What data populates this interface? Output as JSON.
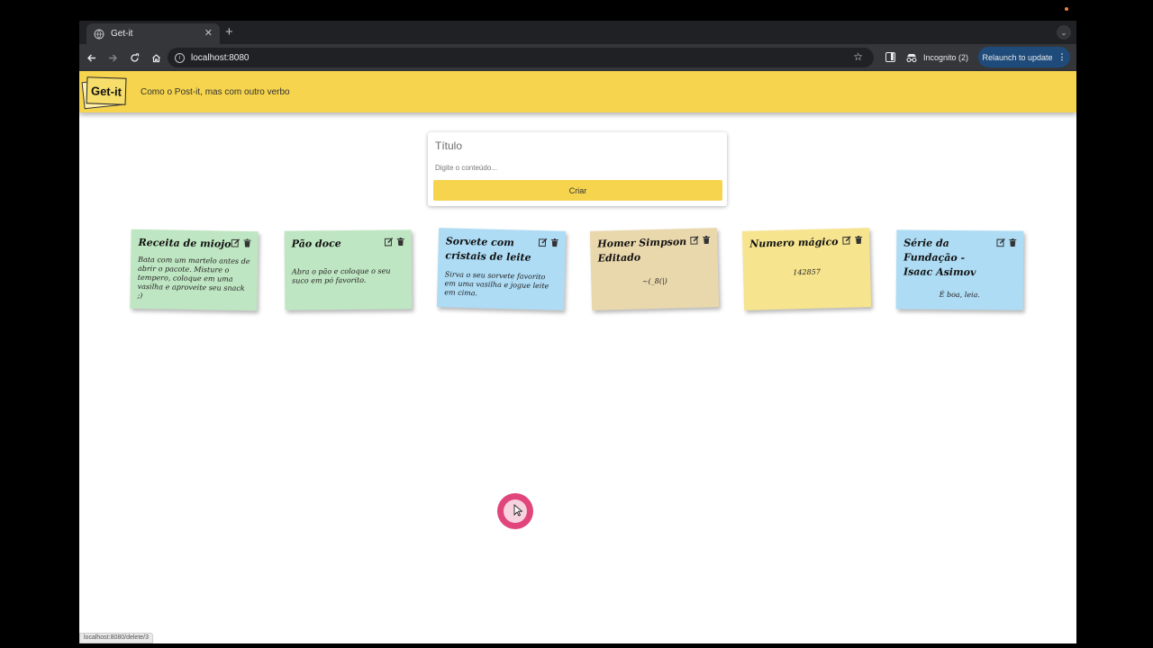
{
  "browser": {
    "tab_title": "Get-it",
    "tab_close": "✕",
    "new_tab": "+",
    "tab_search": "⌄",
    "url": "localhost:8080",
    "incognito_label": "Incognito (2)",
    "relaunch_label": "Relaunch to update",
    "status_url": "localhost:8080/delete/3"
  },
  "app": {
    "logo_text": "Get-it",
    "tagline": "Como o Post-it, mas com outro verbo"
  },
  "form": {
    "title_placeholder": "Título",
    "content_placeholder": "Digite o conteúdo...",
    "create_label": "Criar"
  },
  "notes": [
    {
      "title": "Receita de miojo",
      "body": "Bata com um martelo antes de abrir o pacote. Misture o tempero, coloque em uma vasilha e aproveite seu snack ;)",
      "color": "#bfe6c2"
    },
    {
      "title": "Pão doce",
      "body": "Abra o pão e coloque o seu suco em pó favorito.",
      "color": "#bfe6c2"
    },
    {
      "title": "Sorvete com cristais de leite",
      "body": "Sirva o seu sorvete favorito em uma vasilha e jogue leite em cima.",
      "color": "#aedcf5"
    },
    {
      "title": "Homer Simpson Editado",
      "body": "~(_8(|)",
      "color": "#ead8ad"
    },
    {
      "title": "Numero mágico",
      "body": "142857",
      "color": "#f6e48e"
    },
    {
      "title": "Série da Fundação - Isaac Asimov",
      "body": "É boa, leia.",
      "color": "#aedcf5"
    }
  ],
  "colors": {
    "header_yellow": "#f6d44d",
    "chrome_dark": "#35363a",
    "relaunch_blue": "#1f4b7a"
  }
}
